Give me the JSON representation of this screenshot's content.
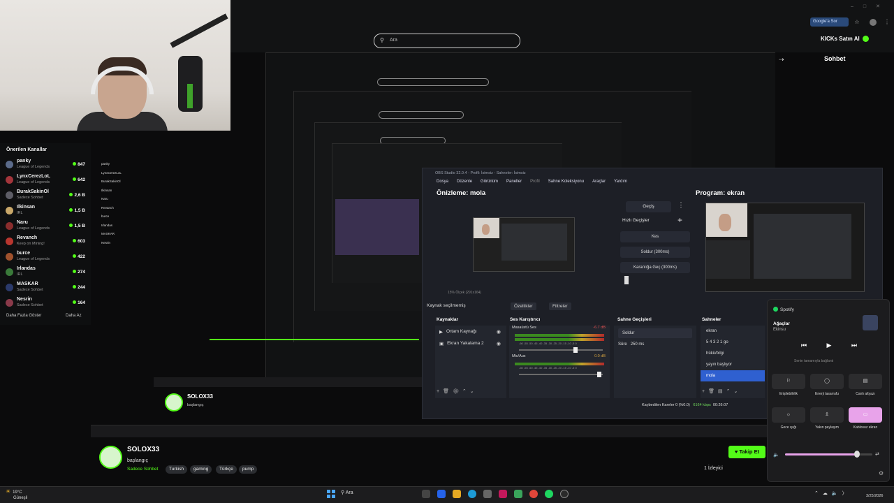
{
  "browser": {
    "search_placeholder": "Ara",
    "google_button": "Google'a Sor",
    "kick_button": "KICKs Satın Al",
    "chat_title": "Sohbet"
  },
  "channels": {
    "title": "Önerilen Kanallar",
    "items": [
      {
        "name": "panky",
        "category": "League of Legends",
        "viewers": "847"
      },
      {
        "name": "LynxCerezLoL",
        "category": "League of Legends",
        "viewers": "642"
      },
      {
        "name": "BurakSakinOl",
        "category": "Sadece Sohbet",
        "viewers": "2,6 B"
      },
      {
        "name": "Ilkinsan",
        "category": "IRL",
        "viewers": "1,5 B"
      },
      {
        "name": "Naru",
        "category": "League of Legends",
        "viewers": "1,5 B"
      },
      {
        "name": "Revanch",
        "category": "Keep on Mining!",
        "viewers": "603"
      },
      {
        "name": "burce",
        "category": "League of Legends",
        "viewers": "422"
      },
      {
        "name": "Irlandas",
        "category": "IRL",
        "viewers": "274"
      },
      {
        "name": "MASKAR",
        "category": "Sadece Sohbet",
        "viewers": "244"
      },
      {
        "name": "Nesrin",
        "category": "Sadece Sohbet",
        "viewers": "164"
      }
    ],
    "show_more": "Daha Fazla Göster",
    "show_less": "Daha Az"
  },
  "obs": {
    "titlebar": "OBS Studio 32.0.4 - Profil: İsimsiz - Sahneler: İsimsiz",
    "menu": [
      "Dosya",
      "Düzenle",
      "Görünüm",
      "Paneller",
      "Profil",
      "Sahne Koleksiyonu",
      "Araçlar",
      "Yardım"
    ],
    "preview_title": "Önizleme: mola",
    "program_title": "Program: ekran",
    "transition_button": "Geçiş",
    "quick_transitions": "Hızlı Geçişler",
    "transitions": [
      "Kes",
      "Soldur (300ms)",
      "Karanlığa Geç (300ms)"
    ],
    "zoom": "15%   Ölçek (291x164)",
    "source_selection": "Kaynak seçilmemiş",
    "properties": "Özellikler",
    "filters": "Filtreler",
    "docks": {
      "sources": "Kaynaklar",
      "mixer": "Ses Karıştırıcı",
      "transitions": "Sahne Geçişleri",
      "scenes": "Sahneler"
    },
    "sources": [
      "Ortam Kaynağı",
      "Ekran Yakalama 2"
    ],
    "mixer": [
      {
        "name": "Masaüstü Ses",
        "db": "-6.7 dB"
      },
      {
        "name": "Mic/Aux",
        "db": "0.0 dB"
      }
    ],
    "mixer_ticks": "-60 -55 -50 -45 -40 -35 -30 -25 -20 -15 -10 -5 0",
    "transition_select": "Soldur",
    "duration_label": "Süre",
    "duration_value": "250 ms",
    "scenes": [
      "ekran",
      "5 4 3 2 1 go",
      "hükü/bilgi",
      "yayın başlıyor",
      "mola"
    ],
    "selected_scene": "mola",
    "status_frames": "Kaybedilen Kareler 0 (%0.0)",
    "status_bitrate": "6164 kbps",
    "status_time": "00:26:07"
  },
  "quick_settings": {
    "app": "Spotify",
    "track": "Ağaçlar",
    "artist": "Ekinsu",
    "sub_caption": "Senin tamamıyla bağlantı",
    "tiles": [
      {
        "label": "Erişilebilirlik",
        "icon": "accessibility-icon"
      },
      {
        "label": "Enerji tasarrufu",
        "icon": "battery-saver-icon"
      },
      {
        "label": "Canlı altyazı",
        "icon": "live-captions-icon"
      },
      {
        "label": "Gece ışığı",
        "icon": "night-light-icon"
      },
      {
        "label": "Yakın paylaşım",
        "icon": "nearby-share-icon"
      },
      {
        "label": "Kablosuz ekran",
        "icon": "cast-icon"
      }
    ],
    "volume": 0.82
  },
  "stream_info": {
    "channel": "SOLOX33",
    "title": "başlangıç",
    "category": "Sadece Sohbet",
    "tags": [
      "Turkish",
      "gaming",
      "Türkçe",
      "pump"
    ],
    "follow": "Takip Et",
    "viewers": "1 İzleyici"
  },
  "taskbar": {
    "temp": "19°C",
    "weather": "Güneşli",
    "search": "Ara",
    "time": "",
    "date": "3/25/2026"
  }
}
